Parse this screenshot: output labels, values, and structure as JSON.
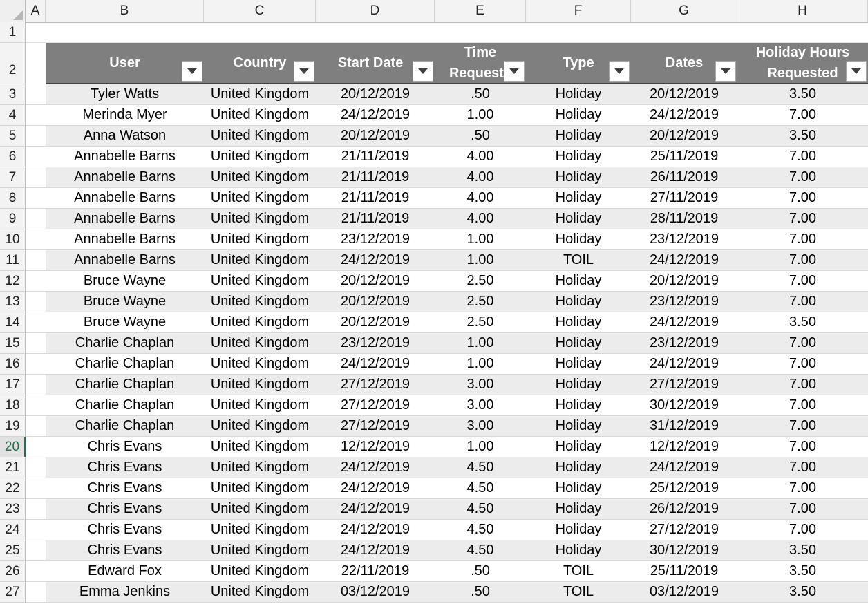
{
  "columns": [
    "A",
    "B",
    "C",
    "D",
    "E",
    "F",
    "G",
    "H"
  ],
  "row_numbers": [
    "1",
    "2",
    "3",
    "4",
    "5",
    "6",
    "7",
    "8",
    "9",
    "10",
    "11",
    "12",
    "13",
    "14",
    "15",
    "16",
    "17",
    "18",
    "19",
    "20",
    "21",
    "22",
    "23",
    "24",
    "25",
    "26",
    "27"
  ],
  "selected_row": "20",
  "table": {
    "headers": [
      {
        "line1": "User",
        "line2": ""
      },
      {
        "line1": "Country",
        "line2": ""
      },
      {
        "line1": "Start Date",
        "line2": ""
      },
      {
        "line1": "Time",
        "line2": "Requeste"
      },
      {
        "line1": "Type",
        "line2": ""
      },
      {
        "line1": "Dates",
        "line2": ""
      },
      {
        "line1": "Holiday Hours",
        "line2": "Requested"
      }
    ],
    "rows": [
      [
        "Tyler Watts",
        "United Kingdom",
        "20/12/2019",
        ".50",
        "Holiday",
        "20/12/2019",
        "3.50"
      ],
      [
        "Merinda Myer",
        "United Kingdom",
        "24/12/2019",
        "1.00",
        "Holiday",
        "24/12/2019",
        "7.00"
      ],
      [
        "Anna Watson",
        "United Kingdom",
        "20/12/2019",
        ".50",
        "Holiday",
        "20/12/2019",
        "3.50"
      ],
      [
        "Annabelle Barns",
        "United Kingdom",
        "21/11/2019",
        "4.00",
        "Holiday",
        "25/11/2019",
        "7.00"
      ],
      [
        "Annabelle Barns",
        "United Kingdom",
        "21/11/2019",
        "4.00",
        "Holiday",
        "26/11/2019",
        "7.00"
      ],
      [
        "Annabelle Barns",
        "United Kingdom",
        "21/11/2019",
        "4.00",
        "Holiday",
        "27/11/2019",
        "7.00"
      ],
      [
        "Annabelle Barns",
        "United Kingdom",
        "21/11/2019",
        "4.00",
        "Holiday",
        "28/11/2019",
        "7.00"
      ],
      [
        "Annabelle Barns",
        "United Kingdom",
        "23/12/2019",
        "1.00",
        "Holiday",
        "23/12/2019",
        "7.00"
      ],
      [
        "Annabelle Barns",
        "United Kingdom",
        "24/12/2019",
        "1.00",
        "TOIL",
        "24/12/2019",
        "7.00"
      ],
      [
        "Bruce Wayne",
        "United Kingdom",
        "20/12/2019",
        "2.50",
        "Holiday",
        "20/12/2019",
        "7.00"
      ],
      [
        "Bruce Wayne",
        "United Kingdom",
        "20/12/2019",
        "2.50",
        "Holiday",
        "23/12/2019",
        "7.00"
      ],
      [
        "Bruce Wayne",
        "United Kingdom",
        "20/12/2019",
        "2.50",
        "Holiday",
        "24/12/2019",
        "3.50"
      ],
      [
        "Charlie Chaplan",
        "United Kingdom",
        "23/12/2019",
        "1.00",
        "Holiday",
        "23/12/2019",
        "7.00"
      ],
      [
        "Charlie Chaplan",
        "United Kingdom",
        "24/12/2019",
        "1.00",
        "Holiday",
        "24/12/2019",
        "7.00"
      ],
      [
        "Charlie Chaplan",
        "United Kingdom",
        "27/12/2019",
        "3.00",
        "Holiday",
        "27/12/2019",
        "7.00"
      ],
      [
        "Charlie Chaplan",
        "United Kingdom",
        "27/12/2019",
        "3.00",
        "Holiday",
        "30/12/2019",
        "7.00"
      ],
      [
        "Charlie Chaplan",
        "United Kingdom",
        "27/12/2019",
        "3.00",
        "Holiday",
        "31/12/2019",
        "7.00"
      ],
      [
        "Chris Evans",
        "United Kingdom",
        "12/12/2019",
        "1.00",
        "Holiday",
        "12/12/2019",
        "7.00"
      ],
      [
        "Chris Evans",
        "United Kingdom",
        "24/12/2019",
        "4.50",
        "Holiday",
        "24/12/2019",
        "7.00"
      ],
      [
        "Chris Evans",
        "United Kingdom",
        "24/12/2019",
        "4.50",
        "Holiday",
        "25/12/2019",
        "7.00"
      ],
      [
        "Chris Evans",
        "United Kingdom",
        "24/12/2019",
        "4.50",
        "Holiday",
        "26/12/2019",
        "7.00"
      ],
      [
        "Chris Evans",
        "United Kingdom",
        "24/12/2019",
        "4.50",
        "Holiday",
        "27/12/2019",
        "7.00"
      ],
      [
        "Chris Evans",
        "United Kingdom",
        "24/12/2019",
        "4.50",
        "Holiday",
        "30/12/2019",
        "3.50"
      ],
      [
        "Edward Fox",
        "United Kingdom",
        "22/11/2019",
        ".50",
        "TOIL",
        "25/11/2019",
        "3.50"
      ],
      [
        "Emma Jenkins",
        "United Kingdom",
        "03/12/2019",
        ".50",
        "TOIL",
        "03/12/2019",
        "3.50"
      ]
    ]
  },
  "colors": {
    "header_bg": "#7f7f7f",
    "band": "#ececec",
    "selected_row_accent": "#217346"
  },
  "icons": {
    "filter_dropdown": "dropdown-arrow-icon",
    "select_all": "select-all-triangle-icon"
  }
}
